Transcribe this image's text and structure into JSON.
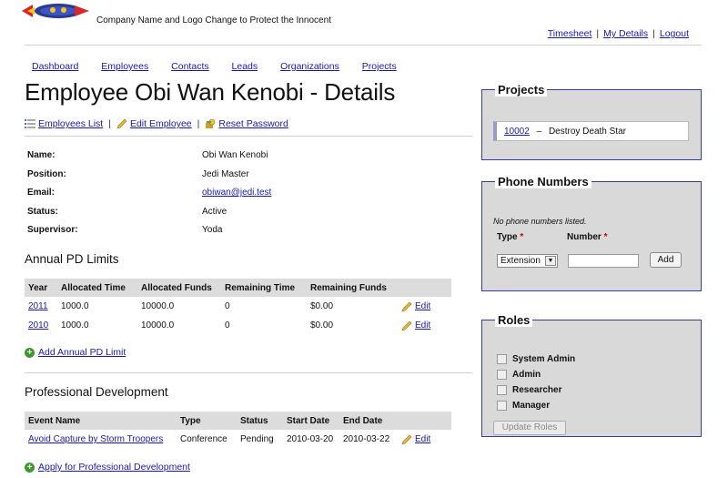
{
  "header": {
    "company": "Company Name and Logo Change to Protect the Innocent",
    "topnav": [
      "Timesheet",
      "My Details",
      "Logout"
    ],
    "sep": "|"
  },
  "mainnav": [
    "Dashboard",
    "Employees",
    "Contacts",
    "Leads",
    "Organizations",
    "Projects"
  ],
  "page_title": "Employee Obi Wan Kenobi - Details",
  "actions": {
    "list": "Employees List",
    "edit": "Edit Employee",
    "reset": "Reset Password",
    "sep": "|"
  },
  "details": [
    {
      "label": "Name:",
      "value": "Obi Wan Kenobi"
    },
    {
      "label": "Position:",
      "value": "Jedi Master"
    },
    {
      "label": "Email:",
      "value": "obiwan@jedi.test"
    },
    {
      "label": "Status:",
      "value": "Active"
    },
    {
      "label": "Supervisor:",
      "value": "Yoda"
    }
  ],
  "pd_limits": {
    "heading": "Annual PD Limits",
    "columns": [
      "Year",
      "Allocated Time",
      "Allocated Funds",
      "Remaining Time",
      "Remaining Funds",
      ""
    ],
    "rows": [
      {
        "year": "2011",
        "alloc_time": "1000.0",
        "alloc_funds": "10000.0",
        "rem_time": "0",
        "rem_funds": "$0.00",
        "edit": "Edit"
      },
      {
        "year": "2010",
        "alloc_time": "1000.0",
        "alloc_funds": "10000.0",
        "rem_time": "0",
        "rem_funds": "$0.00",
        "edit": "Edit"
      }
    ],
    "add": "Add Annual PD Limit"
  },
  "prof_dev": {
    "heading": "Professional Development",
    "columns": [
      "Event Name",
      "Type",
      "Status",
      "Start Date",
      "End Date",
      ""
    ],
    "rows": [
      {
        "event": "Avoid Capture by Storm Troopers",
        "type": "Conference",
        "status": "Pending",
        "start": "2010-03-20",
        "end": "2010-03-22",
        "edit": "Edit"
      }
    ],
    "apply": "Apply for Professional Development"
  },
  "projects": {
    "legend": "Projects",
    "items": [
      {
        "code": "10002",
        "dash": "–",
        "name": "Destroy Death Star"
      }
    ]
  },
  "phones": {
    "legend": "Phone Numbers",
    "empty": "No phone numbers listed.",
    "type_label": "Type",
    "number_label": "Number",
    "required": "*",
    "type_value": "Extension",
    "add_button": "Add"
  },
  "roles": {
    "legend": "Roles",
    "items": [
      "System Admin",
      "Admin",
      "Researcher",
      "Manager"
    ],
    "update_button": "Update Roles"
  },
  "colors": {
    "link": "#1a1aa6",
    "box_border": "#3a3a9c",
    "box_bg": "#d9d9d9",
    "table_header": "#dcdcdc"
  }
}
